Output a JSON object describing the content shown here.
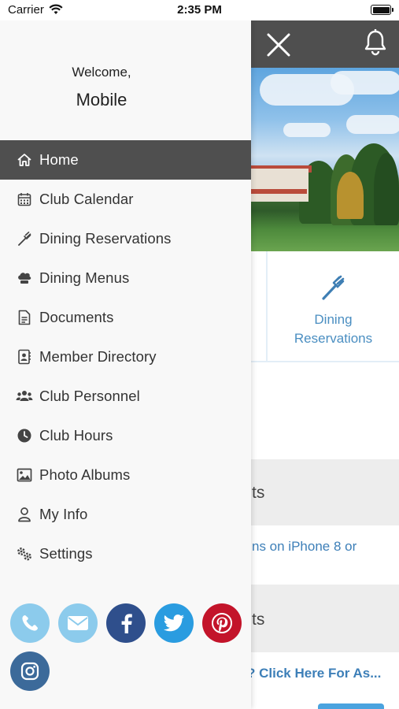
{
  "status_bar": {
    "carrier": "Carrier",
    "time": "2:35 PM"
  },
  "drawer": {
    "welcome": "Welcome,",
    "username": "Mobile",
    "menu": [
      {
        "label": "Home",
        "icon": "home-icon",
        "active": true
      },
      {
        "label": "Club Calendar",
        "icon": "calendar-icon"
      },
      {
        "label": "Dining Reservations",
        "icon": "fork-icon"
      },
      {
        "label": "Dining Menus",
        "icon": "chef-hat-icon"
      },
      {
        "label": "Documents",
        "icon": "document-icon"
      },
      {
        "label": "Member Directory",
        "icon": "contact-book-icon"
      },
      {
        "label": "Club Personnel",
        "icon": "users-icon"
      },
      {
        "label": "Club Hours",
        "icon": "clock-icon"
      },
      {
        "label": "Photo Albums",
        "icon": "image-icon"
      },
      {
        "label": "My Info",
        "icon": "user-icon"
      },
      {
        "label": "Settings",
        "icon": "gears-icon"
      }
    ],
    "social": [
      {
        "name": "phone-icon",
        "color": "#8ccbec"
      },
      {
        "name": "email-icon",
        "color": "#8ccbec"
      },
      {
        "name": "facebook-icon",
        "color": "#2f4f8c"
      },
      {
        "name": "twitter-icon",
        "color": "#2a9ce0"
      },
      {
        "name": "pinterest-icon",
        "color": "#c3142a"
      },
      {
        "name": "instagram-icon",
        "color": "#3c6a9a"
      }
    ]
  },
  "page": {
    "tile_label": "Dining\nReservations",
    "sections": [
      {
        "title": "ts",
        "text": "ns on iPhone 8 or"
      },
      {
        "title": "ts",
        "text": "? Click Here For As..."
      }
    ]
  },
  "colors": {
    "accent": "#4a8ec1",
    "header": "#4f4f4f",
    "active_menu": "#4f4f4f"
  }
}
